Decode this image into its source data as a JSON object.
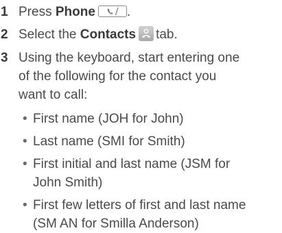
{
  "steps": [
    {
      "number": "1",
      "prefix": "Press ",
      "bold": "Phone",
      "suffix": "."
    },
    {
      "number": "2",
      "prefix": "Select the ",
      "bold": "Contacts",
      "suffix": "tab."
    },
    {
      "number": "3",
      "lines": [
        "Using the keyboard, start entering one",
        "of the following for the contact you",
        "want to call:"
      ]
    }
  ],
  "bullets": [
    {
      "lines": [
        "First name (JOH for John)"
      ]
    },
    {
      "lines": [
        "Last name (SMI for Smith)"
      ]
    },
    {
      "lines": [
        "First initial and last name (JSM for",
        "John Smith)"
      ]
    },
    {
      "lines": [
        "First few letters of first and last name",
        "(SM AN for Smilla Anderson)"
      ]
    }
  ],
  "icons": {
    "phone_key": "phone-icon",
    "contacts_tab": "contacts-icon"
  }
}
